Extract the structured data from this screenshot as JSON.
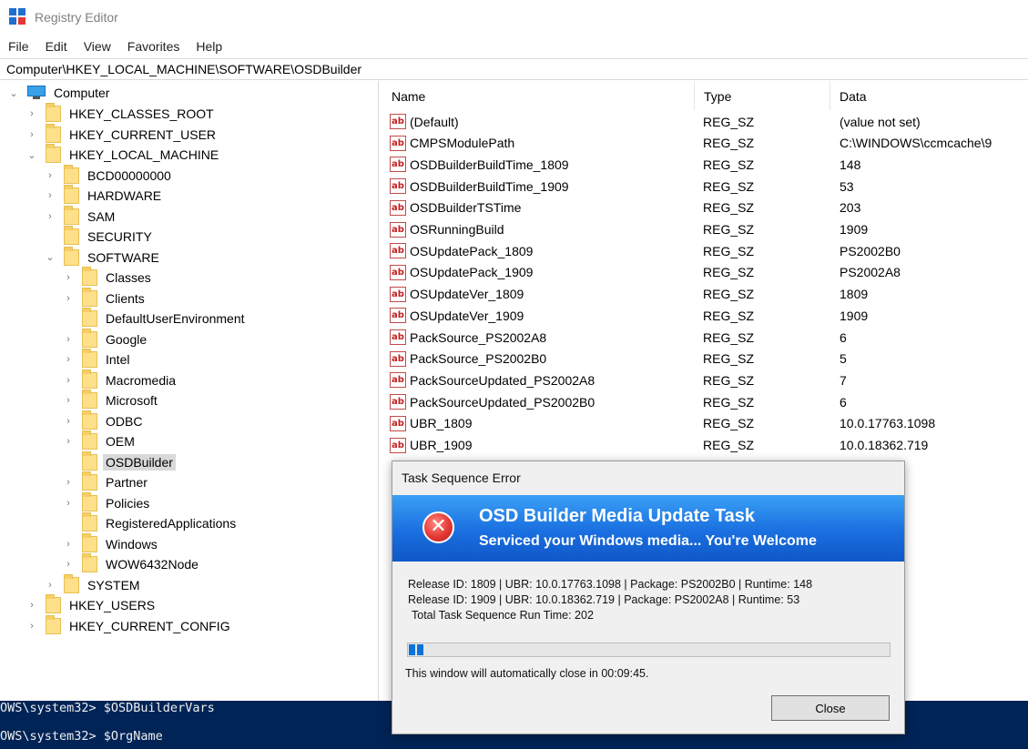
{
  "window": {
    "title": "Registry Editor"
  },
  "menu": [
    "File",
    "Edit",
    "View",
    "Favorites",
    "Help"
  ],
  "address": "Computer\\HKEY_LOCAL_MACHINE\\SOFTWARE\\OSDBuilder",
  "tree": {
    "root": "Computer",
    "items": [
      {
        "label": "HKEY_CLASSES_ROOT"
      },
      {
        "label": "HKEY_CURRENT_USER"
      },
      {
        "label": "HKEY_LOCAL_MACHINE"
      },
      {
        "label": "BCD00000000"
      },
      {
        "label": "HARDWARE"
      },
      {
        "label": "SAM"
      },
      {
        "label": "SECURITY"
      },
      {
        "label": "SOFTWARE"
      },
      {
        "label": "Classes"
      },
      {
        "label": "Clients"
      },
      {
        "label": "DefaultUserEnvironment"
      },
      {
        "label": "Google"
      },
      {
        "label": "Intel"
      },
      {
        "label": "Macromedia"
      },
      {
        "label": "Microsoft"
      },
      {
        "label": "ODBC"
      },
      {
        "label": "OEM"
      },
      {
        "label": "OSDBuilder"
      },
      {
        "label": "Partner"
      },
      {
        "label": "Policies"
      },
      {
        "label": "RegisteredApplications"
      },
      {
        "label": "Windows"
      },
      {
        "label": "WOW6432Node"
      },
      {
        "label": "SYSTEM"
      },
      {
        "label": "HKEY_USERS"
      },
      {
        "label": "HKEY_CURRENT_CONFIG"
      }
    ]
  },
  "values": {
    "headers": {
      "name": "Name",
      "type": "Type",
      "data": "Data"
    },
    "rows": [
      {
        "name": "(Default)",
        "type": "REG_SZ",
        "data": "(value not set)"
      },
      {
        "name": "CMPSModulePath",
        "type": "REG_SZ",
        "data": "C:\\WINDOWS\\ccmcache\\9"
      },
      {
        "name": "OSDBuilderBuildTime_1809",
        "type": "REG_SZ",
        "data": "148"
      },
      {
        "name": "OSDBuilderBuildTime_1909",
        "type": "REG_SZ",
        "data": "53"
      },
      {
        "name": "OSDBuilderTSTime",
        "type": "REG_SZ",
        "data": "203"
      },
      {
        "name": "OSRunningBuild",
        "type": "REG_SZ",
        "data": "1909"
      },
      {
        "name": "OSUpdatePack_1809",
        "type": "REG_SZ",
        "data": "PS2002B0"
      },
      {
        "name": "OSUpdatePack_1909",
        "type": "REG_SZ",
        "data": "PS2002A8"
      },
      {
        "name": "OSUpdateVer_1809",
        "type": "REG_SZ",
        "data": "1809"
      },
      {
        "name": "OSUpdateVer_1909",
        "type": "REG_SZ",
        "data": "1909"
      },
      {
        "name": "PackSource_PS2002A8",
        "type": "REG_SZ",
        "data": "6"
      },
      {
        "name": "PackSource_PS2002B0",
        "type": "REG_SZ",
        "data": "5"
      },
      {
        "name": "PackSourceUpdated_PS2002A8",
        "type": "REG_SZ",
        "data": "7"
      },
      {
        "name": "PackSourceUpdated_PS2002B0",
        "type": "REG_SZ",
        "data": "6"
      },
      {
        "name": "UBR_1809",
        "type": "REG_SZ",
        "data": "10.0.17763.1098"
      },
      {
        "name": "UBR_1909",
        "type": "REG_SZ",
        "data": "10.0.18362.719"
      }
    ]
  },
  "console": {
    "lines": [
      "OWS\\system32> $OSDBuilderVars",
      "OWS\\system32> $OrgName"
    ]
  },
  "dialog": {
    "title": "Task Sequence Error",
    "heading": "OSD Builder Media Update Task",
    "subheading": "Serviced your Windows media... You're Welcome",
    "line1": "Release ID: 1809 | UBR: 10.0.17763.1098 | Package: PS2002B0 | Runtime: 148",
    "line2": "Release ID: 1909 | UBR: 10.0.18362.719 | Package: PS2002A8 | Runtime: 53",
    "line3": "Total Task Sequence Run Time: 202",
    "progress_fraction": 0.04,
    "autoclose": "This window will automatically close in 00:09:45.",
    "close_label": "Close",
    "error_glyph": "✕"
  },
  "colors": {
    "banner": "#1a6fe0",
    "console_bg": "#012456",
    "folder": "#ffe08a"
  }
}
